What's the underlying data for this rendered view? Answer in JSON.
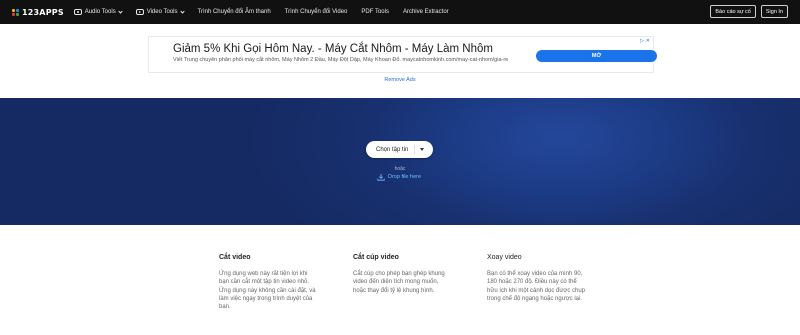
{
  "brand": {
    "name": "123APPS",
    "dot_colors": [
      "#f4b400",
      "#1e88e5",
      "#e53935",
      "#43a047"
    ]
  },
  "nav": [
    {
      "label": "Audio Tools",
      "icon": "music-icon",
      "dropdown": true
    },
    {
      "label": "Video Tools",
      "icon": "video-icon",
      "dropdown": true
    },
    {
      "label": "Trình Chuyển đổi Âm thanh"
    },
    {
      "label": "Trình Chuyển đổi Video"
    },
    {
      "label": "PDF Tools"
    },
    {
      "label": "Archive Extractor"
    }
  ],
  "header_buttons": {
    "report": "Báo cáo sự cố",
    "signin": "Sign In"
  },
  "ad": {
    "title": "Giảm 5% Khi Gọi Hôm Nay. - Máy Cắt Nhôm - Máy Làm Nhôm",
    "description": "Viết Trung chuyên phân phối máy cắt nhôm, Máy Nhôm 2 Đầu, Máy Đột Dập, Máy Khoan Đổ. maycatnhomkinh.com/may-cat-nhom/gia-re",
    "cta": "MỞ",
    "badges": [
      "▷",
      "✕"
    ],
    "remove_label": "Remove Ads"
  },
  "hero": {
    "choose_label": "Chọn tập tin",
    "or_label": "hoặc",
    "drop_label": "Drop file here"
  },
  "features": [
    {
      "title": "Cắt video",
      "text": "Ứng dụng web này rất tiện lợi khi bạn cần cắt một tập tin video nhỏ. Ứng dụng này không cần cài đặt, và làm việc ngay trong trình duyệt của bạn."
    },
    {
      "title": "Cắt cúp video",
      "text": "Cắt cúp cho phép bạn ghép khung video đến diện tích mong muốn, hoặc thay đổi tỷ lệ khung hình."
    },
    {
      "title": "Xoay video",
      "text": "Bạn có thể xoay video của mình 90, 180 hoặc 270 độ. Điều này có thể hữu ích khi một cảnh dọc được chụp trong chế độ ngang hoặc ngược lại."
    }
  ],
  "colors": {
    "topbar": "#111111",
    "hero": "#1c3b85",
    "link": "#2a6ad8",
    "cta": "#1a73e8"
  }
}
